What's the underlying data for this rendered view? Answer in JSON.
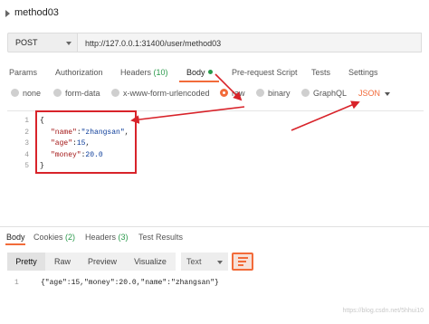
{
  "request": {
    "title": "method03",
    "method": "POST",
    "url": "http://127.0.0.1:31400/user/method03"
  },
  "tabs": [
    {
      "label": "Params"
    },
    {
      "label": "Authorization"
    },
    {
      "label": "Headers",
      "count": "(10)"
    },
    {
      "label": "Body",
      "active": true
    },
    {
      "label": "Pre-request Script"
    },
    {
      "label": "Tests"
    },
    {
      "label": "Settings"
    }
  ],
  "body_types": {
    "options": [
      "none",
      "form-data",
      "x-www-form-urlencoded",
      "raw",
      "binary",
      "GraphQL"
    ],
    "selected": "raw",
    "format": "JSON"
  },
  "editor": {
    "line_numbers": [
      "1",
      "2",
      "3",
      "4",
      "5"
    ],
    "lines": [
      {
        "parts": [
          [
            "p",
            "{"
          ]
        ]
      },
      {
        "parts": [
          [
            "k",
            "\"name\""
          ],
          [
            "p",
            ":"
          ],
          [
            "s",
            "\"zhangsan\""
          ],
          [
            "p",
            ","
          ]
        ]
      },
      {
        "parts": [
          [
            "k",
            "\"age\""
          ],
          [
            "p",
            ":"
          ],
          [
            "s",
            "15"
          ],
          [
            "p",
            ","
          ]
        ]
      },
      {
        "parts": [
          [
            "k",
            "\"money\""
          ],
          [
            "p",
            ":"
          ],
          [
            "s",
            "20.0"
          ]
        ]
      },
      {
        "parts": [
          [
            "p",
            "}"
          ]
        ]
      }
    ]
  },
  "response": {
    "tabs": [
      {
        "label": "Body",
        "active": true
      },
      {
        "label": "Cookies",
        "count": "(2)"
      },
      {
        "label": "Headers",
        "count": "(3)"
      },
      {
        "label": "Test Results"
      }
    ],
    "views": [
      "Pretty",
      "Raw",
      "Preview",
      "Visualize"
    ],
    "active_view": "Pretty",
    "format": "Text",
    "line_number": "1",
    "body": "{\"age\":15,\"money\":20.0,\"name\":\"zhangsan\"}"
  },
  "watermark": "https://blog.csdn.net/5hhui10",
  "colors": {
    "accent": "#f26b3a",
    "annotation": "#d8232a",
    "count_green": "#2a9a4b"
  },
  "icons": [
    "caret-right-icon",
    "chevron-down-icon",
    "radio-button-icon",
    "wrap-lines-icon"
  ]
}
